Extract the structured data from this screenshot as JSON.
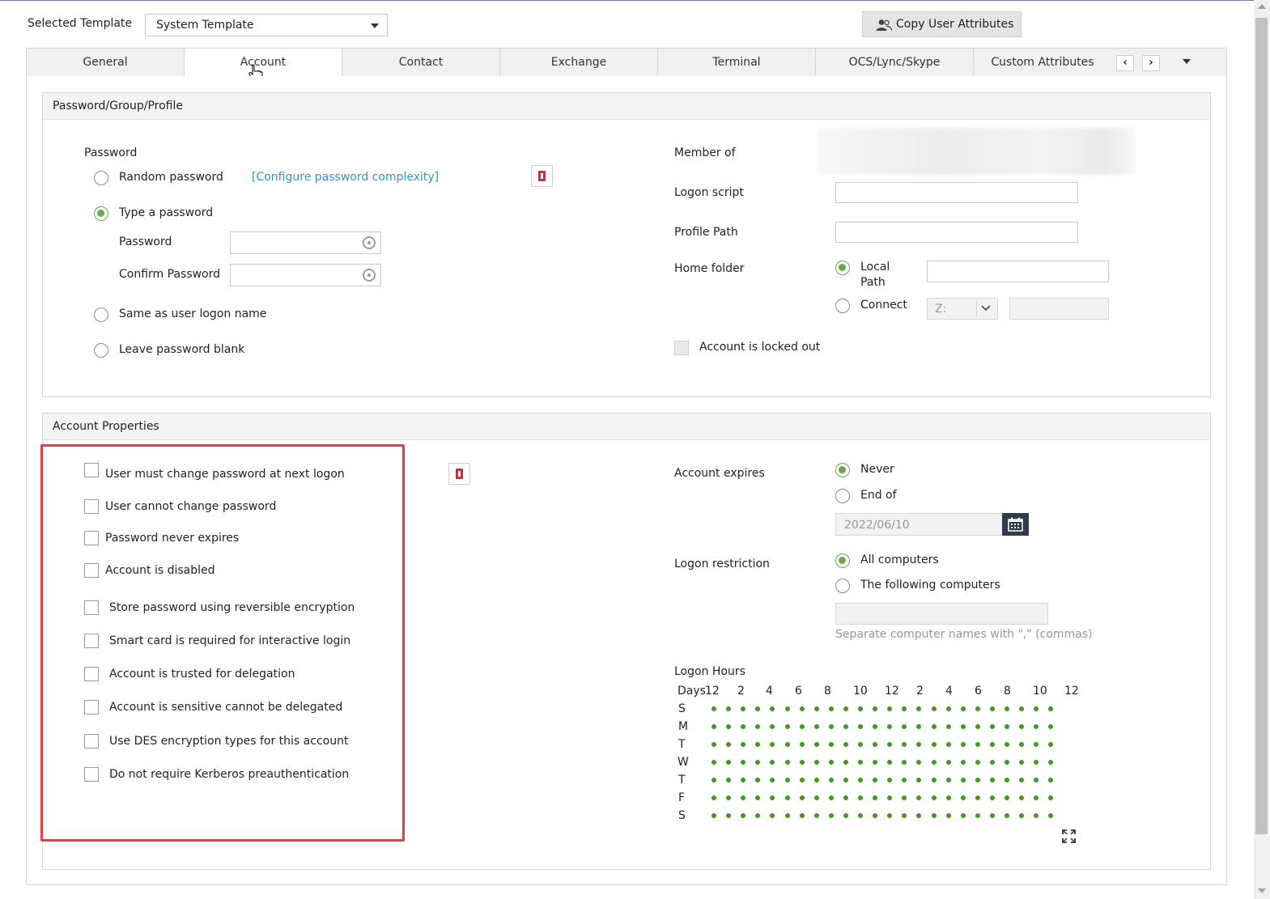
{
  "header": {
    "selected_template_label": "Selected Template",
    "selected_template_value": "System Template",
    "copy_button_label": "Copy User Attributes"
  },
  "tabs": [
    {
      "label": "General"
    },
    {
      "label": "Account"
    },
    {
      "label": "Contact"
    },
    {
      "label": "Exchange"
    },
    {
      "label": "Terminal"
    },
    {
      "label": "OCS/Lync/Skype"
    },
    {
      "label": "Custom Attributes"
    }
  ],
  "active_tab": "Account",
  "password_section": {
    "title": "Password/Group/Profile",
    "password_heading": "Password",
    "random_password_label": "Random password",
    "configure_link": "[Configure password complexity]",
    "type_password_label": "Type a password",
    "password_field_label": "Password",
    "confirm_password_label": "Confirm Password",
    "same_as_logon_label": "Same as user logon name",
    "leave_blank_label": "Leave password blank",
    "selected_option": "Type a password",
    "member_of_label": "Member of",
    "logon_script_label": "Logon script",
    "profile_path_label": "Profile Path",
    "home_folder_label": "Home folder",
    "local_path_label_1": "Local",
    "local_path_label_2": "Path",
    "connect_label": "Connect",
    "drive_value": "Z:",
    "locked_out_label": "Account is locked out"
  },
  "account_properties": {
    "title": "Account Properties",
    "options": [
      {
        "label": "User must change password at next logon",
        "checked": false
      },
      {
        "label": "User cannot change password",
        "checked": false
      },
      {
        "label": "Password never expires",
        "checked": false
      },
      {
        "label": "Account is disabled",
        "checked": false
      },
      {
        "label": "Store password using reversible encryption",
        "checked": false
      },
      {
        "label": "Smart card is required for interactive login",
        "checked": false
      },
      {
        "label": "Account is trusted for delegation",
        "checked": false
      },
      {
        "label": "Account is sensitive cannot be delegated",
        "checked": false
      },
      {
        "label": "Use DES encryption types for this account",
        "checked": false
      },
      {
        "label": "Do not require Kerberos preauthentication",
        "checked": false
      }
    ],
    "account_expires_label": "Account expires",
    "never_label": "Never",
    "end_of_label": "End of",
    "expiry_date": "2022/06/10",
    "logon_restriction_label": "Logon restriction",
    "all_computers_label": "All computers",
    "following_computers_label": "The following computers",
    "computers_hint": "Separate computer names with \",\" (commas)",
    "logon_hours_label": "Logon Hours",
    "days_label": "Days",
    "hour_ticks": [
      "12",
      "2",
      "4",
      "6",
      "8",
      "10",
      "12",
      "2",
      "4",
      "6",
      "8",
      "10",
      "12"
    ],
    "days": [
      "S",
      "M",
      "T",
      "W",
      "T",
      "F",
      "S"
    ]
  },
  "colors": {
    "accent_green": "#6aa84f",
    "dot_green": "#3f9a1f",
    "highlight_red": "#e04040",
    "link_blue": "#3a8fc7"
  },
  "icons": [
    "chevron-down-icon",
    "users-icon",
    "office-icon",
    "eye-icon",
    "calendar-icon",
    "expand-icon",
    "chevron-left-icon",
    "chevron-right-icon",
    "cursor-hand-icon"
  ]
}
